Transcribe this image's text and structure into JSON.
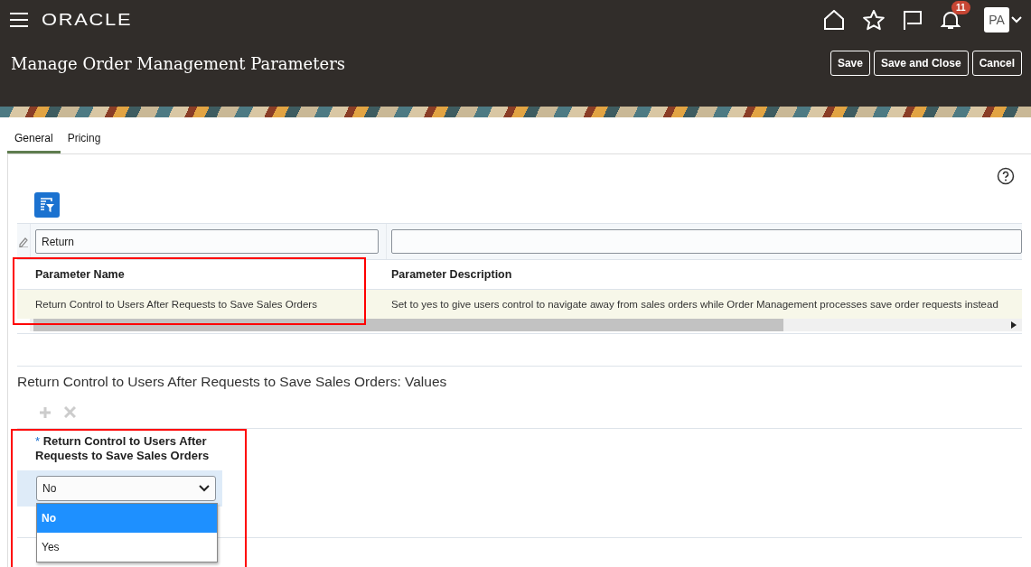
{
  "header": {
    "logo": "ORACLE",
    "notification_count": "11",
    "avatar_initials": "PA"
  },
  "page": {
    "title": "Manage Order Management Parameters",
    "buttons": [
      "Save",
      "Save and Close",
      "Cancel"
    ]
  },
  "tabs": [
    {
      "label": "General",
      "selected": true
    },
    {
      "label": "Pricing",
      "selected": false
    }
  ],
  "parameters_table": {
    "filters": [
      {
        "value": "Return"
      }
    ],
    "columns": [
      "Parameter Name",
      "Parameter Description"
    ],
    "rows": [
      {
        "cells": [
          "Return Control to Users After Requests to Save Sales Orders",
          "Set to yes to give users control to navigate away from sales orders while Order Management processes save order requests instead"
        ],
        "selected": true
      }
    ]
  },
  "values_section": {
    "title": "Return Control to Users After Requests to Save Sales Orders: Values",
    "column": {
      "required_mark": "*",
      "label": "Return Control to Users After Requests to Save Sales Orders"
    },
    "select": {
      "value": "No",
      "options": [
        {
          "label": "No",
          "selected": true
        },
        {
          "label": "Yes",
          "selected": false
        }
      ]
    }
  }
}
